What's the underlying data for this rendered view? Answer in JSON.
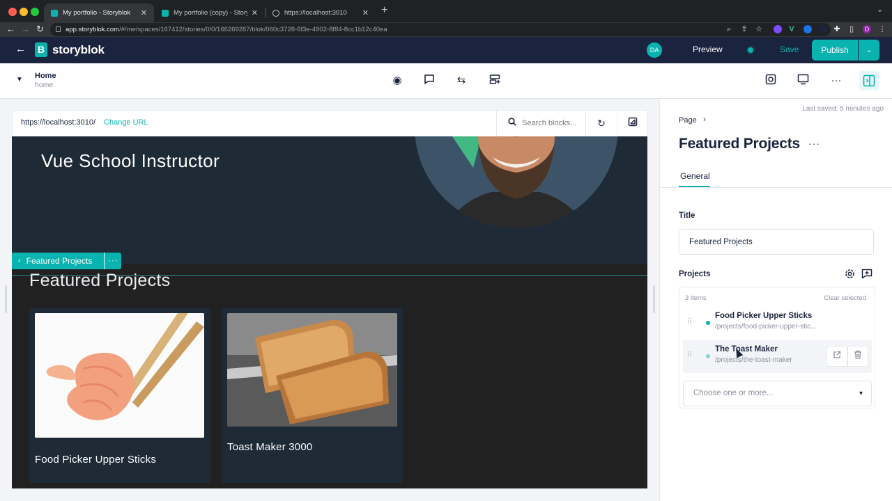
{
  "browser": {
    "tabs": [
      {
        "title": "My portfolio - Storyblok",
        "close": "✕"
      },
      {
        "title": "My portfolio (copy) - Storyblok",
        "close": "✕"
      },
      {
        "title": "https://localhost:3010",
        "close": "✕"
      }
    ],
    "new_tab": "+",
    "url_host": "app.storyblok.com",
    "url_path": "/#/me/spaces/167412/stories/0/0/166269267/blok/060c3728-6f3e-4902-8f84-8cc1b12c40ea",
    "profile_initial": "D"
  },
  "header": {
    "logo_mark": "B",
    "logo_text": "storyblok",
    "avatar_initials": "DA",
    "preview_label": "Preview",
    "save_label": "Save",
    "publish_label": "Publish",
    "accent_color": "#09b3af",
    "nav_color": "#1b243f"
  },
  "toolbar": {
    "story_name": "Home",
    "story_slug": "home"
  },
  "preview": {
    "current_url": "https://localhost:3010/",
    "change_url_label": "Change URL",
    "search_placeholder": "Search blocks...",
    "hero_title": "Vue School Instructor",
    "section_title": "Featured Projects",
    "block_tag_label": "Featured Projects",
    "cards": [
      {
        "title": "Food Picker Upper Sticks"
      },
      {
        "title": "Toast Maker 3000"
      }
    ]
  },
  "panel": {
    "last_saved": "Last saved: 5 minutes ago",
    "breadcrumb": "Page",
    "title": "Featured Projects",
    "tab_general": "General",
    "title_label": "Title",
    "title_value": "Featured Projects",
    "projects_label": "Projects",
    "items_count": "2 items",
    "clear_selected": "Clear selected",
    "projects": [
      {
        "name": "Food Picker Upper Sticks",
        "path": "/projects/food-picker-upper-stic..."
      },
      {
        "name": "The Toast Maker",
        "path": "/projects/the-toast-maker"
      }
    ],
    "choose_placeholder": "Choose one or more..."
  }
}
